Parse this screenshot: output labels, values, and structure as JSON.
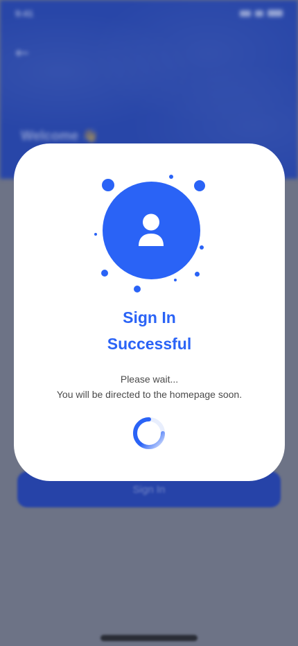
{
  "status_bar": {
    "time": "9:41"
  },
  "background": {
    "welcome_text": "Welcome 👋",
    "primary_button_label": "Sign In"
  },
  "modal": {
    "title_line1": "Sign In",
    "title_line2": "Successful",
    "message_line1": "Please wait...",
    "message_line2": "You will be directed to the homepage soon.",
    "icon": "user-icon",
    "loading_icon": "spinner-icon"
  },
  "colors": {
    "accent": "#2a63f6",
    "header_bg": "#2846a8",
    "overlay": "#6d7386",
    "modal_bg": "#ffffff"
  }
}
